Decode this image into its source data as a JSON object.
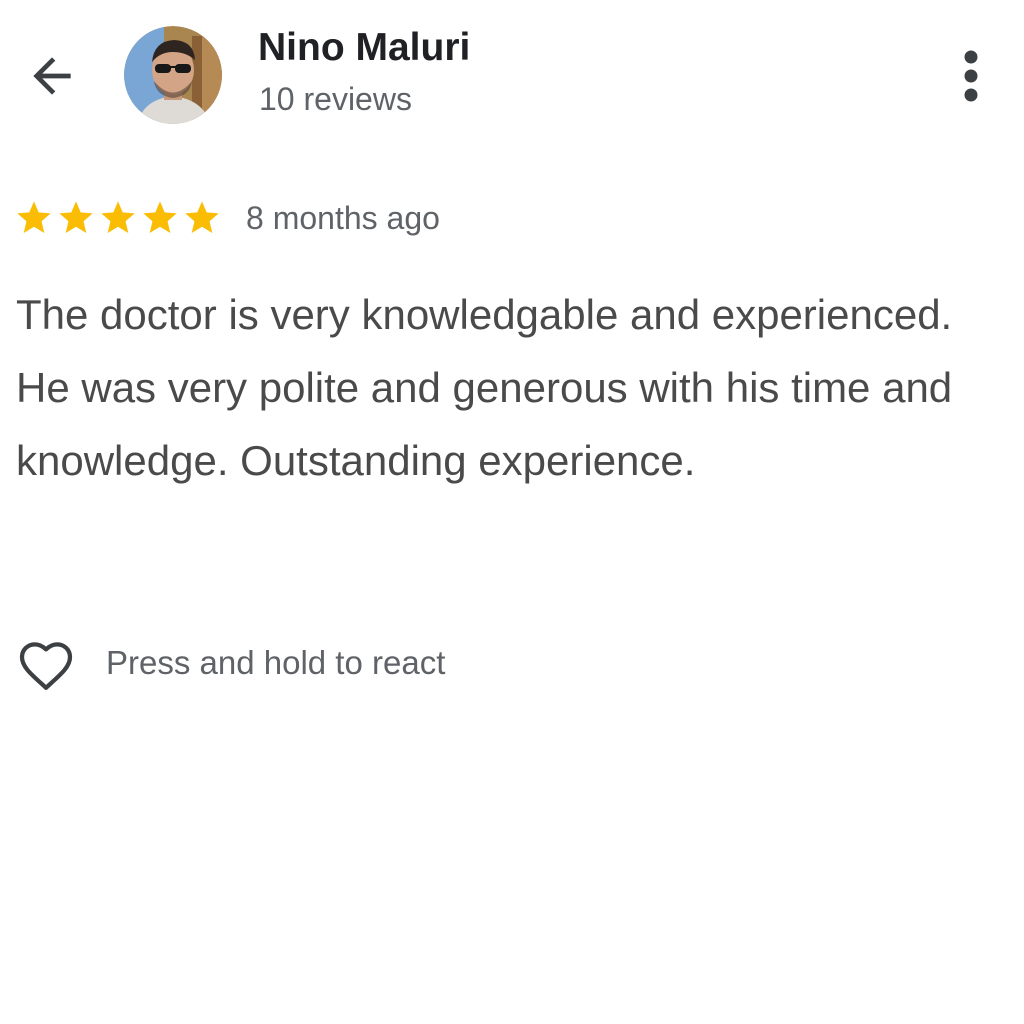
{
  "header": {
    "author_name": "Nino Maluri",
    "review_count": "10 reviews",
    "back_icon": "arrow-left-icon",
    "more_icon": "more-vertical-icon"
  },
  "review": {
    "rating": 5,
    "max_rating": 5,
    "time_ago": "8 months ago",
    "text": "The doctor is very knowledgable and experienced. He was very polite and generous with his time and knowledge. Outstanding experience."
  },
  "reaction": {
    "icon": "heart-outline-icon",
    "label": "Press and hold to react"
  },
  "colors": {
    "star": "#fbbc04",
    "star_empty": "#dadce0",
    "text_primary": "#202124",
    "text_secondary": "#5f6368",
    "icon": "#3c4043"
  }
}
